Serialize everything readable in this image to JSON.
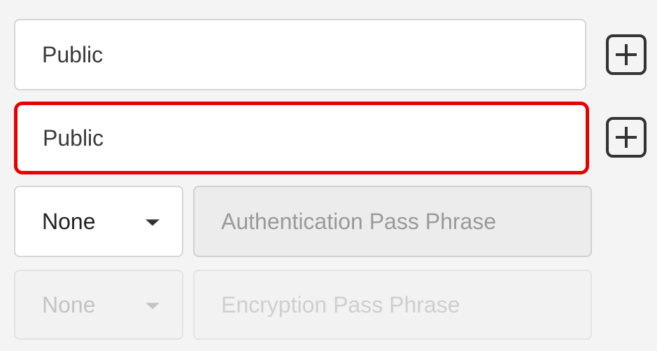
{
  "community": {
    "read_value": "Public",
    "write_value": "Public"
  },
  "authentication": {
    "protocol_selected": "None",
    "pass_phrase_placeholder": "Authentication Pass Phrase"
  },
  "encryption": {
    "protocol_selected": "None",
    "pass_phrase_placeholder": "Encryption Pass Phrase"
  },
  "icons": {
    "add": "plus-square-icon"
  },
  "colors": {
    "highlight": "#e60000",
    "background": "#f4f4f5"
  }
}
